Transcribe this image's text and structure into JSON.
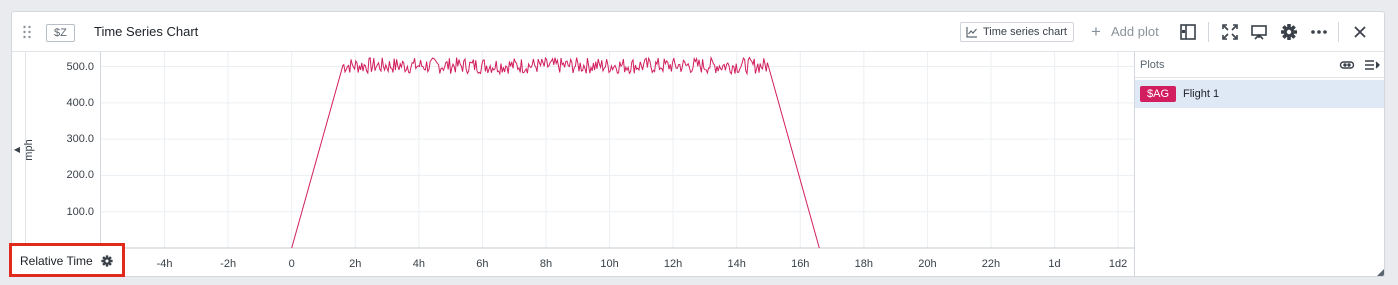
{
  "header": {
    "variable_tag": "$Z",
    "title": "Time Series Chart",
    "chart_type_label": "Time series chart",
    "add_plot_label": "Add plot",
    "icons": [
      "drag-handle-icon",
      "line-chart-icon",
      "plus-icon",
      "sidebar-toggle-icon",
      "fullscreen-icon",
      "presentation-icon",
      "gear-icon",
      "more-icon",
      "close-icon"
    ]
  },
  "chart": {
    "y_axis_label": "mph",
    "y_ticks": [
      "500.0",
      "400.0",
      "300.0",
      "200.0",
      "100.0"
    ],
    "x_ticks": [
      "-4h",
      "-2h",
      "0",
      "2h",
      "4h",
      "6h",
      "8h",
      "10h",
      "12h",
      "14h",
      "16h",
      "18h",
      "20h",
      "22h",
      "1d",
      "1d2"
    ],
    "series_color": "#d21e5e"
  },
  "chart_data": {
    "type": "line",
    "title": "",
    "xlabel": "",
    "ylabel": "mph",
    "xlim_hours": [
      -6,
      26.5
    ],
    "ylim": [
      0,
      540
    ],
    "grid": true,
    "series": [
      {
        "name": "Flight 1",
        "color": "#d21e5e",
        "x_hours": [
          0,
          1.6,
          15,
          16.6
        ],
        "y": [
          0,
          500,
          500,
          0
        ],
        "noise_band": [
          480,
          525
        ]
      }
    ]
  },
  "sidebar": {
    "title": "Plots",
    "plots": [
      {
        "tag": "$AG",
        "name": "Flight 1",
        "color": "#d21e5e"
      }
    ]
  },
  "time_control": {
    "label": "Relative Time"
  }
}
